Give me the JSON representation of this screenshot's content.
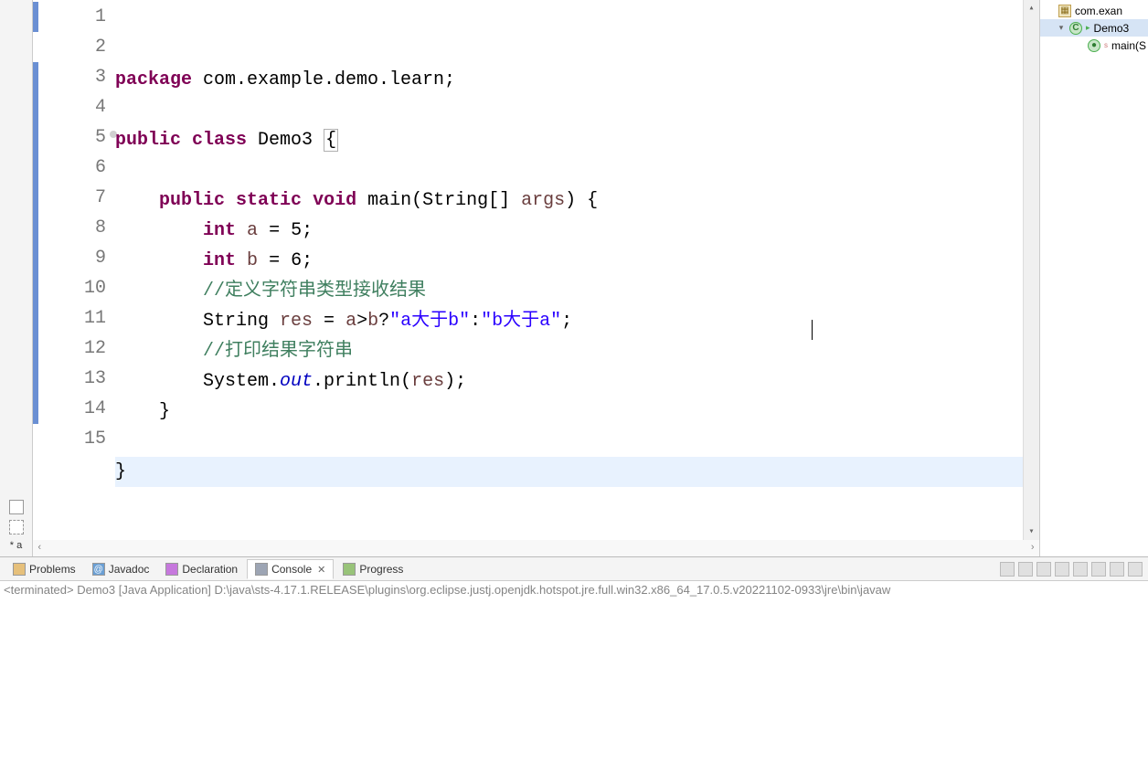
{
  "editor": {
    "lines": [
      {
        "n": "1",
        "marked": true,
        "ann": false,
        "tokens": [
          {
            "cls": "kw",
            "t": "package"
          },
          {
            "cls": "plain",
            "t": " com.example.demo.learn;"
          }
        ]
      },
      {
        "n": "2",
        "marked": false,
        "ann": false,
        "tokens": [
          {
            "cls": "plain",
            "t": ""
          }
        ]
      },
      {
        "n": "3",
        "marked": true,
        "ann": false,
        "bracket": true,
        "tokens": [
          {
            "cls": "kw",
            "t": "public"
          },
          {
            "cls": "plain",
            "t": " "
          },
          {
            "cls": "kw",
            "t": "class"
          },
          {
            "cls": "plain",
            "t": " Demo3 "
          },
          {
            "cls": "plain bracket",
            "t": "{"
          }
        ]
      },
      {
        "n": "4",
        "marked": true,
        "ann": false,
        "tokens": [
          {
            "cls": "plain",
            "t": ""
          }
        ]
      },
      {
        "n": "5",
        "marked": true,
        "ann": true,
        "indent": 1,
        "tokens": [
          {
            "cls": "kw",
            "t": "public"
          },
          {
            "cls": "plain",
            "t": " "
          },
          {
            "cls": "kw",
            "t": "static"
          },
          {
            "cls": "plain",
            "t": " "
          },
          {
            "cls": "kw",
            "t": "void"
          },
          {
            "cls": "plain",
            "t": " main(String[] "
          },
          {
            "cls": "arg",
            "t": "args"
          },
          {
            "cls": "plain",
            "t": ") {"
          }
        ]
      },
      {
        "n": "6",
        "marked": true,
        "ann": false,
        "indent": 2,
        "tokens": [
          {
            "cls": "kw",
            "t": "int"
          },
          {
            "cls": "plain",
            "t": " "
          },
          {
            "cls": "var",
            "t": "a"
          },
          {
            "cls": "plain",
            "t": " = 5;"
          }
        ]
      },
      {
        "n": "7",
        "marked": true,
        "ann": false,
        "indent": 2,
        "tokens": [
          {
            "cls": "kw",
            "t": "int"
          },
          {
            "cls": "plain",
            "t": " "
          },
          {
            "cls": "var",
            "t": "b"
          },
          {
            "cls": "plain",
            "t": " = 6;"
          }
        ]
      },
      {
        "n": "8",
        "marked": true,
        "ann": false,
        "indent": 2,
        "tokens": [
          {
            "cls": "cmt",
            "t": "//定义字符串类型接收结果"
          }
        ]
      },
      {
        "n": "9",
        "marked": true,
        "ann": false,
        "indent": 2,
        "tokens": [
          {
            "cls": "plain",
            "t": "String "
          },
          {
            "cls": "var",
            "t": "res"
          },
          {
            "cls": "plain",
            "t": " = "
          },
          {
            "cls": "var",
            "t": "a"
          },
          {
            "cls": "plain",
            "t": ">"
          },
          {
            "cls": "var",
            "t": "b"
          },
          {
            "cls": "plain",
            "t": "?"
          },
          {
            "cls": "str",
            "t": "\"a大于b\""
          },
          {
            "cls": "plain",
            "t": ":"
          },
          {
            "cls": "str",
            "t": "\"b大于a\""
          },
          {
            "cls": "plain",
            "t": ";"
          }
        ]
      },
      {
        "n": "10",
        "marked": true,
        "ann": false,
        "indent": 2,
        "tokens": [
          {
            "cls": "cmt",
            "t": "//打印结果字符串"
          }
        ]
      },
      {
        "n": "11",
        "marked": true,
        "ann": false,
        "indent": 2,
        "tokens": [
          {
            "cls": "plain",
            "t": "System."
          },
          {
            "cls": "field",
            "t": "out"
          },
          {
            "cls": "plain",
            "t": ".println("
          },
          {
            "cls": "var",
            "t": "res"
          },
          {
            "cls": "plain",
            "t": ");"
          }
        ]
      },
      {
        "n": "12",
        "marked": true,
        "ann": false,
        "indent": 1,
        "tokens": [
          {
            "cls": "plain",
            "t": "}"
          }
        ]
      },
      {
        "n": "13",
        "marked": true,
        "ann": false,
        "tokens": [
          {
            "cls": "plain",
            "t": ""
          }
        ]
      },
      {
        "n": "14",
        "marked": true,
        "ann": false,
        "hl": true,
        "tokens": [
          {
            "cls": "plain",
            "t": "}"
          }
        ]
      },
      {
        "n": "15",
        "marked": false,
        "ann": false,
        "tokens": [
          {
            "cls": "plain",
            "t": ""
          }
        ]
      }
    ],
    "cursor": {
      "line": 11,
      "col": 62
    }
  },
  "outline": {
    "items": [
      {
        "level": 1,
        "icon": "pkg",
        "label": "com.exan",
        "tw": ""
      },
      {
        "level": 2,
        "icon": "cls",
        "label": "Demo3",
        "tw": "▾",
        "sel": true,
        "run": true
      },
      {
        "level": 3,
        "icon": "mth",
        "label": "main(S",
        "sup": "s"
      }
    ]
  },
  "left_label": "* a",
  "tabs": {
    "items": [
      {
        "id": "problems",
        "label": "Problems",
        "icon": "#e6c07b",
        "active": false
      },
      {
        "id": "javadoc",
        "label": "Javadoc",
        "icon": "#6a9fd4",
        "active": false,
        "prefix": "@"
      },
      {
        "id": "declaration",
        "label": "Declaration",
        "icon": "#c678dd",
        "active": false
      },
      {
        "id": "console",
        "label": "Console",
        "icon": "#9da5b4",
        "active": true,
        "closable": true
      },
      {
        "id": "progress",
        "label": "Progress",
        "icon": "#98c379",
        "active": false
      }
    ]
  },
  "console": {
    "status": "<terminated> Demo3 [Java Application] D:\\java\\sts-4.17.1.RELEASE\\plugins\\org.eclipse.justj.openjdk.hotspot.jre.full.win32.x86_64_17.0.5.v20221102-0933\\jre\\bin\\javaw"
  }
}
